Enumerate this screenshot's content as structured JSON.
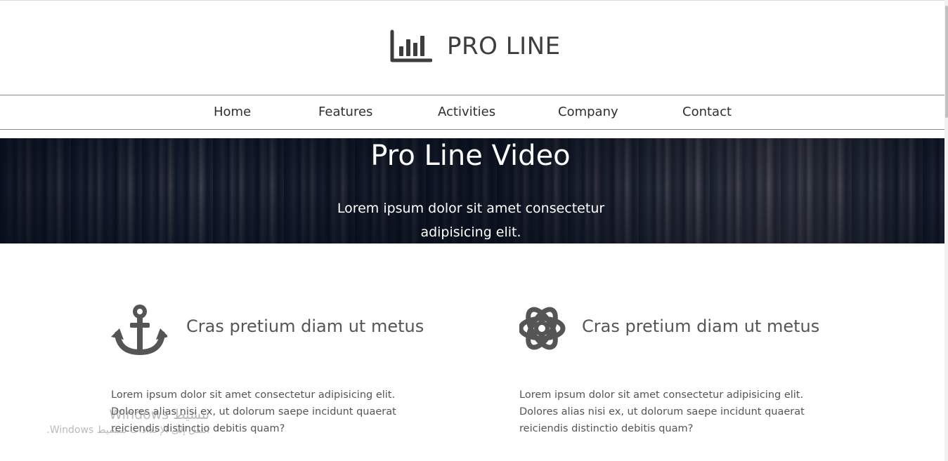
{
  "brand": {
    "title": "PRO LINE",
    "icon": "bar-chart-icon"
  },
  "nav": {
    "items": [
      {
        "label": "Home"
      },
      {
        "label": "Features"
      },
      {
        "label": "Activities"
      },
      {
        "label": "Company"
      },
      {
        "label": "Contact"
      }
    ]
  },
  "hero": {
    "title": "Pro Line Video",
    "subtitle": "Lorem ipsum dolor sit amet consectetur adipisicing elit."
  },
  "features": [
    {
      "icon": "anchor-icon",
      "heading": "Cras pretium diam ut metus",
      "text": "Lorem ipsum dolor sit amet consectetur adipisicing elit. Dolores alias nisi ex, ut dolorum saepe incidunt quaerat reiciendis distinctio debitis quam?"
    },
    {
      "icon": "atom-icon",
      "heading": "Cras pretium diam ut metus",
      "text": "Lorem ipsum dolor sit amet consectetur adipisicing elit. Dolores alias nisi ex, ut dolorum saepe incidunt quaerat reiciendis distinctio debitis quam?"
    }
  ],
  "watermark": {
    "title": "تنشيط Windows",
    "subtitle": "انتقل إلى الإعدادات لتنشيط Windows."
  },
  "colors": {
    "text_dark": "#333333",
    "icon_gray": "#555555",
    "hero_bg": "#0c1424",
    "nav_border": "#8c8c8c"
  }
}
